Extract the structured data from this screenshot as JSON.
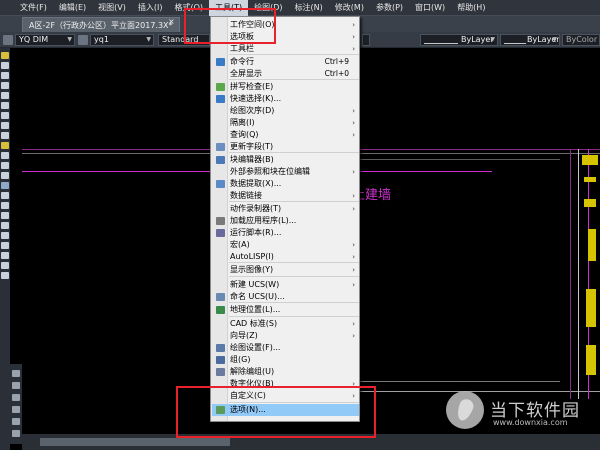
{
  "menubar": {
    "items": [
      "文件(F)",
      "编辑(E)",
      "视图(V)",
      "插入(I)",
      "格式(O)",
      "工具(T)",
      "绘图(D)",
      "标注(N)",
      "修改(M)",
      "参数(P)",
      "窗口(W)",
      "帮助(H)"
    ],
    "active_index": 5
  },
  "tabbar": {
    "tab_title": "A区-2F（行政办公区）平立面2017.3X*",
    "close_glyph": "×"
  },
  "toolbar": {
    "dim_style": "YQ DIM",
    "layer": "yq1",
    "text_style": "Standard",
    "linetype": "ByLayer",
    "lineweight": "ByLayer",
    "plotstyle": "ByColor"
  },
  "tools_menu": {
    "items": [
      {
        "label": "工作空间(O)",
        "submenu": true
      },
      {
        "label": "选项板",
        "submenu": true
      },
      {
        "label": "工具栏",
        "submenu": true
      },
      {
        "label": "命令行",
        "shortcut": "Ctrl+9",
        "icon": "command-line-icon"
      },
      {
        "label": "全屏显示",
        "shortcut": "Ctrl+0"
      },
      {
        "label": "拼写检查(E)",
        "icon": "spell-check-icon"
      },
      {
        "label": "快速选择(K)...",
        "icon": "quick-select-icon"
      },
      {
        "label": "绘图次序(D)",
        "submenu": true
      },
      {
        "label": "隔离(I)",
        "submenu": true
      },
      {
        "label": "查询(Q)",
        "submenu": true
      },
      {
        "label": "更新字段(T)",
        "icon": "update-field-icon"
      },
      {
        "label": "块编辑器(B)",
        "icon": "block-editor-icon"
      },
      {
        "label": "外部参照和块在位编辑",
        "submenu": true
      },
      {
        "label": "数据提取(X)...",
        "icon": "data-extraction-icon"
      },
      {
        "label": "数据链接",
        "submenu": true
      },
      {
        "label": "动作录制器(T)",
        "submenu": true
      },
      {
        "label": "加载应用程序(L)...",
        "icon": "load-application-icon"
      },
      {
        "label": "运行脚本(R)...",
        "icon": "run-script-icon"
      },
      {
        "label": "宏(A)",
        "submenu": true
      },
      {
        "label": "AutoLISP(I)",
        "submenu": true
      },
      {
        "label": "显示图像(Y)",
        "submenu": true
      },
      {
        "label": "新建 UCS(W)",
        "submenu": true
      },
      {
        "label": "命名 UCS(U)...",
        "icon": "named-ucs-icon"
      },
      {
        "label": "地理位置(L)...",
        "icon": "geographic-location-icon"
      },
      {
        "label": "CAD 标准(S)",
        "submenu": true
      },
      {
        "label": "向导(Z)",
        "submenu": true
      },
      {
        "label": "绘图设置(F)...",
        "icon": "drafting-settings-icon"
      },
      {
        "label": "组(G)",
        "icon": "group-icon"
      },
      {
        "label": "解除编组(U)",
        "icon": "ungroup-icon"
      },
      {
        "label": "数字化仪(B)",
        "submenu": true
      },
      {
        "label": "自定义(C)",
        "submenu": true
      },
      {
        "label": "选项(N)...",
        "icon": "options-icon",
        "highlighted": true
      }
    ]
  },
  "canvas": {
    "title_text": "土建墙"
  },
  "watermark": {
    "title": "当下软件园",
    "url": "www.downxia.com"
  },
  "colors": {
    "highlight": "#91c9f7",
    "annotation_red": "#e8212b",
    "cad_magenta": "#cc33cc",
    "cad_yellow": "#d6c400"
  }
}
